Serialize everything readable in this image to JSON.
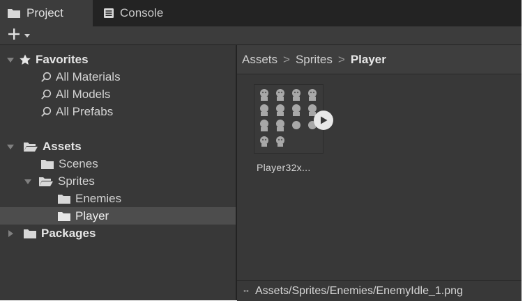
{
  "tabs": {
    "project": "Project",
    "console": "Console"
  },
  "toolbar": {
    "add_label": "+",
    "add_icon": "plus-icon",
    "menu_icon": "caret-down-icon"
  },
  "tree": {
    "favorites": {
      "label": "Favorites",
      "items": [
        "All Materials",
        "All Models",
        "All Prefabs"
      ]
    },
    "assets": {
      "label": "Assets",
      "scenes": "Scenes",
      "sprites": "Sprites",
      "enemies": "Enemies",
      "player": "Player"
    },
    "packages": "Packages"
  },
  "breadcrumb": {
    "items": [
      "Assets",
      "Sprites",
      "Player"
    ],
    "separator": ">"
  },
  "asset": {
    "label": "Player32x..."
  },
  "status": {
    "path": "Assets/Sprites/Enemies/EnemyIdle_1.png"
  },
  "colors": {
    "background": "#383838",
    "tabbar": "#232323",
    "selected": "#4d4d4d",
    "text": "#d2d2d2"
  }
}
